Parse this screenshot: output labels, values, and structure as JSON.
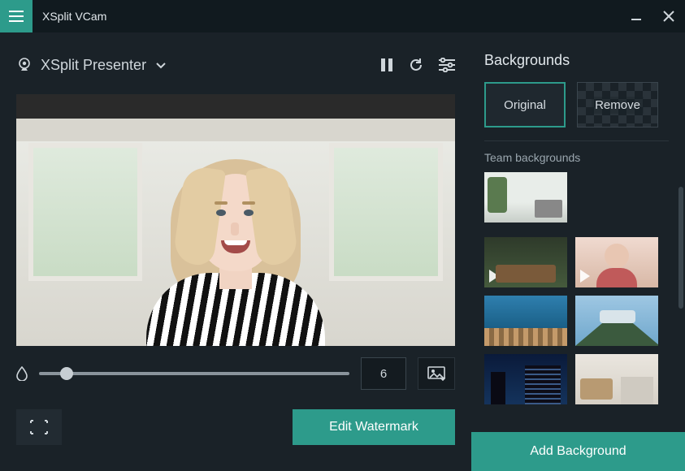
{
  "titlebar": {
    "app_title": "XSplit VCam"
  },
  "camera": {
    "selected": "XSplit Presenter"
  },
  "controls": {
    "blur_value": "6"
  },
  "buttons": {
    "edit_watermark": "Edit Watermark",
    "add_background": "Add Background"
  },
  "backgrounds": {
    "heading": "Backgrounds",
    "options": {
      "original": "Original",
      "remove": "Remove"
    },
    "team_heading": "Team backgrounds"
  },
  "icons": {
    "hamburger": "hamburger-icon",
    "minimize": "minimize-icon",
    "close": "close-icon",
    "webcam": "webcam-icon",
    "chevron_down": "chevron-down-icon",
    "pause": "pause-icon",
    "refresh": "refresh-icon",
    "sliders": "sliders-icon",
    "droplet": "droplet-icon",
    "image_swap": "image-swap-icon",
    "snapshot": "snapshot-icon"
  },
  "colors": {
    "accent": "#2d9b8b",
    "bg": "#1a2228"
  }
}
